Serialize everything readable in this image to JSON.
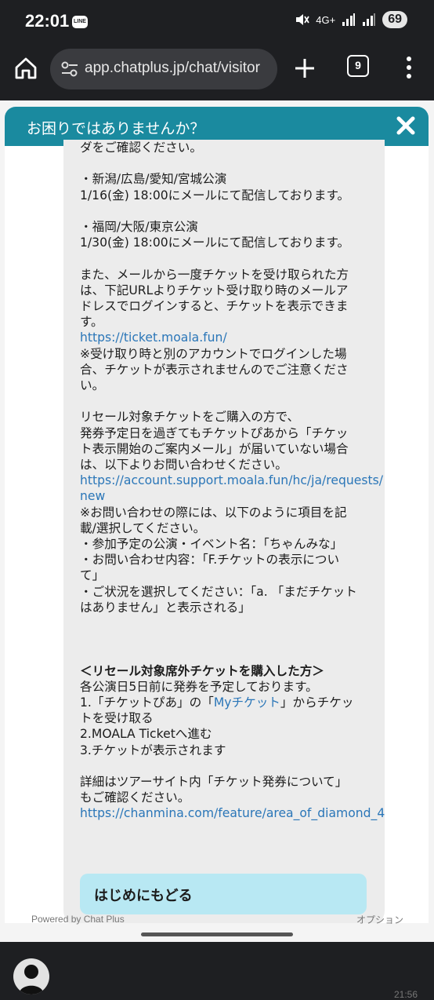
{
  "status_bar": {
    "time": "22:01",
    "line_badge": "LINE",
    "network": "4G+",
    "battery": "69"
  },
  "browser": {
    "url": "app.chatplus.jp/chat/visitor",
    "tab_count": "9",
    "icons": [
      "home-icon",
      "tune-icon",
      "plus-icon",
      "tabs-icon",
      "more-vert-icon"
    ]
  },
  "chat": {
    "header_title": "お困りではありませんか？",
    "message_lines": [
      {
        "text": "ダをご確認ください。",
        "style": "text"
      },
      {
        "text": "",
        "style": "text"
      },
      {
        "text": "・新潟/広島/愛知/宮城公演",
        "style": "text"
      },
      {
        "text": "1/16(金) 18:00にメールにて配信しております。",
        "style": "text"
      },
      {
        "text": "",
        "style": "text"
      },
      {
        "text": "・福岡/大阪/東京公演",
        "style": "text"
      },
      {
        "text": "1/30(金) 18:00にメールにて配信しております。",
        "style": "text"
      },
      {
        "text": "",
        "style": "text"
      },
      {
        "text": "また、メールから一度チケットを受け取られた方",
        "style": "text"
      },
      {
        "text": "は、下記URLよりチケット受け取り時のメールア",
        "style": "text"
      },
      {
        "text": "ドレスでログインすると、チケットを表示できま",
        "style": "text"
      },
      {
        "text": "す。",
        "style": "text"
      },
      {
        "text": "https://ticket.moala.fun/",
        "style": "link"
      },
      {
        "text": "※受け取り時と別のアカウントでログインした場",
        "style": "text"
      },
      {
        "text": "合、チケットが表示されませんのでご注意くださ",
        "style": "text"
      },
      {
        "text": "い。",
        "style": "text"
      },
      {
        "text": "",
        "style": "text"
      },
      {
        "text": "リセール対象チケットをご購入の方で、",
        "style": "text"
      },
      {
        "text": "発券予定日を過ぎてもチケットぴあから「チケッ",
        "style": "text"
      },
      {
        "text": "ト表示開始のご案内メール」が届いていない場合",
        "style": "text"
      },
      {
        "text": "は、以下よりお問い合わせください。",
        "style": "text"
      },
      {
        "text": "https://account.support.moala.fun/hc/ja/requests/",
        "style": "link"
      },
      {
        "text": "new",
        "style": "link"
      },
      {
        "text": "※お問い合わせの際には、以下のように項目を記",
        "style": "text"
      },
      {
        "text": "載/選択してください。",
        "style": "text"
      },
      {
        "text": "・参加予定の公演・イベント名：「ちゃんみな」",
        "style": "text"
      },
      {
        "text": "・お問い合わせ内容：「F.チケットの表示につい",
        "style": "text"
      },
      {
        "text": "て」",
        "style": "text"
      },
      {
        "text": "・ご状況を選択してください：「a. 「まだチケット",
        "style": "text"
      },
      {
        "text": "はありません」と表示される」",
        "style": "text"
      },
      {
        "text": "",
        "style": "text"
      },
      {
        "text": "",
        "style": "text"
      },
      {
        "text": "",
        "style": "text"
      },
      {
        "text": "＜リセール対象席外チケットを購入した方＞",
        "style": "bold"
      },
      {
        "text": "各公演日5日前に発券を予定しております。",
        "style": "text"
      },
      {
        "text": "1.「チケットぴあ」の「Myチケット」からチケッ",
        "style": "text",
        "link_part": "Myチケット"
      },
      {
        "text": "トを受け取る",
        "style": "text"
      },
      {
        "text": "2.MOALA Ticketへ進む",
        "style": "text"
      },
      {
        "text": "3.チケットが表示されます",
        "style": "text"
      },
      {
        "text": "",
        "style": "text"
      },
      {
        "text": "詳細はツアーサイト内「チケット発券について」",
        "style": "text"
      },
      {
        "text": "もご確認ください。",
        "style": "text"
      },
      {
        "text": "https://chanmina.com/feature/area_of_diamond_4",
        "style": "link"
      }
    ],
    "return_button_label": "はじめにもどる",
    "message_time": "21:56",
    "footer_powered": "Powered by Chat Plus",
    "footer_option": "オプション"
  },
  "colors": {
    "header_teal": "#1a8a9f",
    "link_blue": "#2a76b8",
    "button_cyan": "#b8e8f3",
    "bubble_gray": "#ececec"
  }
}
